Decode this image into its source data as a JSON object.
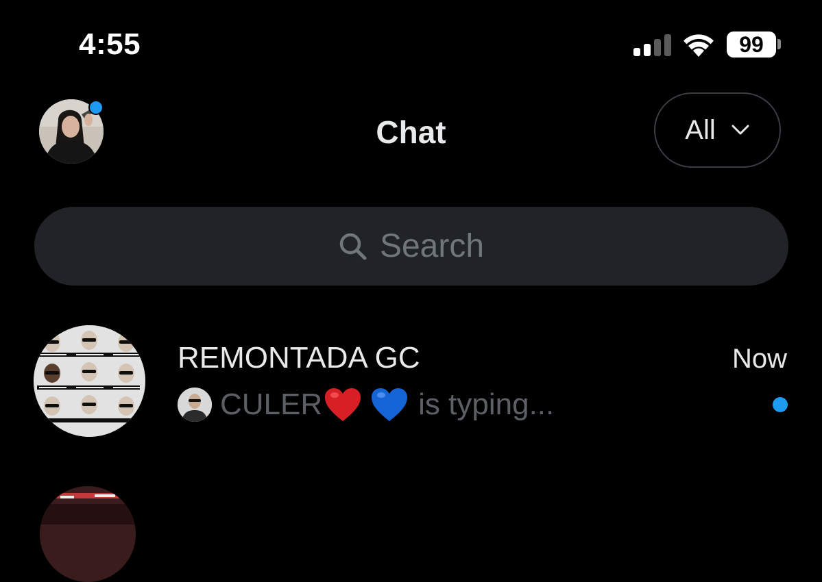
{
  "status_bar": {
    "time": "4:55",
    "battery_level": "99",
    "signal_bars_active": 2,
    "signal_bars_total": 4
  },
  "header": {
    "title": "Chat",
    "filter_label": "All",
    "filter_icon": "chevron-down-icon"
  },
  "search": {
    "placeholder": "Search",
    "icon": "search-icon"
  },
  "conversations": [
    {
      "name": "REMONTADA GC",
      "time": "Now",
      "preview_sender": "CULER",
      "preview_emojis": [
        "red-heart",
        "blue-heart"
      ],
      "preview_status": "is typing...",
      "unread": true
    },
    {
      "name": "",
      "time": ""
    }
  ],
  "colors": {
    "background": "#000000",
    "accent": "#1d9bf0",
    "search_bg": "#202327",
    "muted_text": "#71767b"
  }
}
